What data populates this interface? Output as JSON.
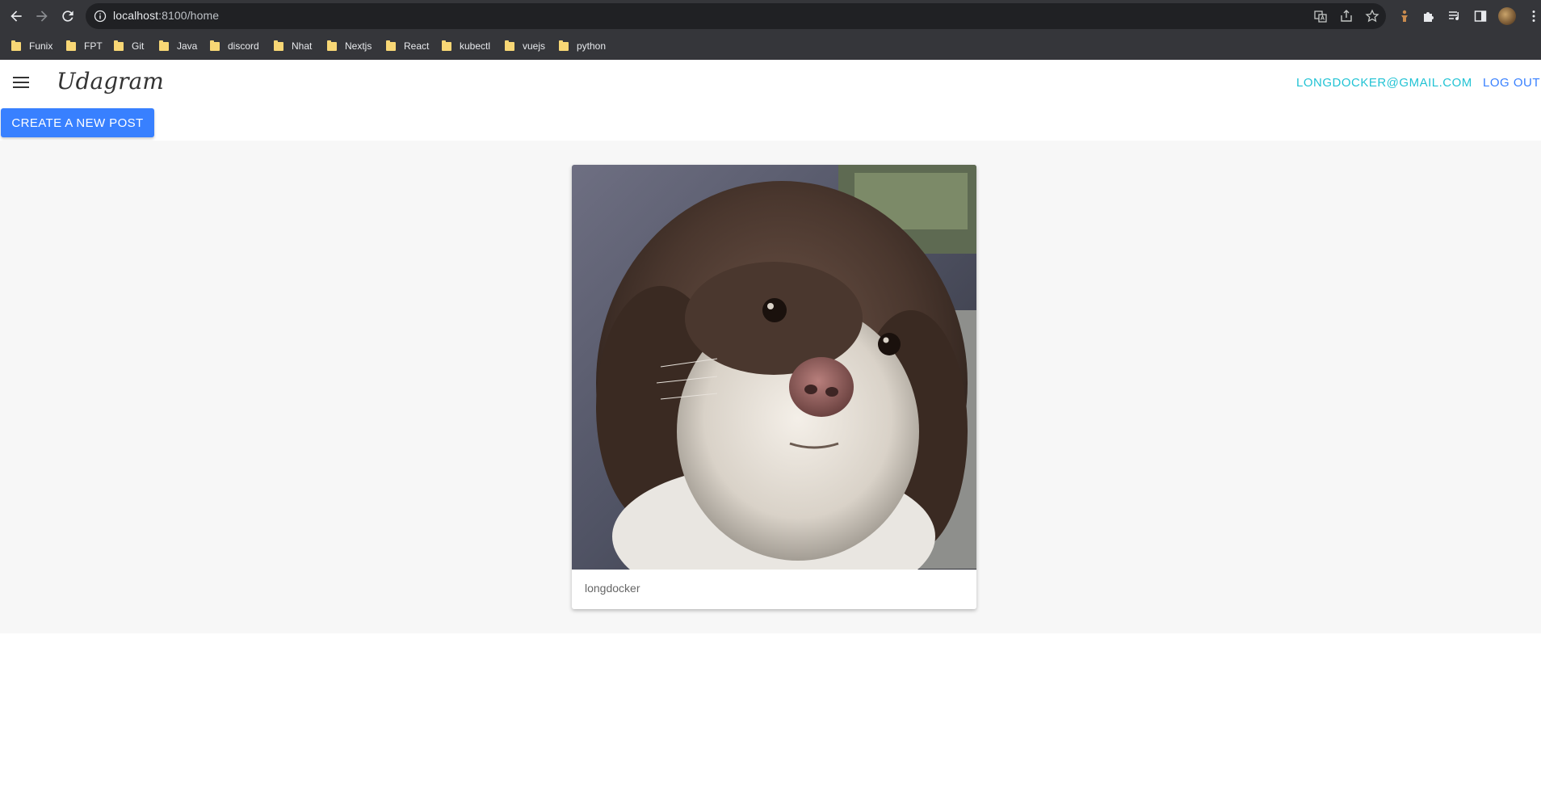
{
  "browser": {
    "url_host": "localhost",
    "url_rest": ":8100/home",
    "bookmarks": [
      "Funix",
      "FPT",
      "Git",
      "Java",
      "discord",
      "Nhat",
      "Nextjs",
      "React",
      "kubectl",
      "vuejs",
      "python"
    ]
  },
  "header": {
    "brand": "Udagram",
    "user_email": "LONGDOCKER@GMAIL.COM",
    "logout_label": "LOG OUT"
  },
  "main": {
    "create_post_label": "CREATE A NEW POST",
    "posts": [
      {
        "author": "longdocker",
        "image_icon": "dog-photo"
      }
    ]
  },
  "colors": {
    "primary": "#3880ff",
    "secondary": "#22c3d4",
    "chrome_dark": "#35363a"
  }
}
